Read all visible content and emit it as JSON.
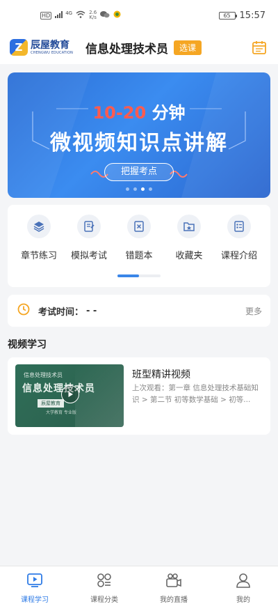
{
  "status_bar": {
    "left_badge": "HD",
    "signal_label": "4G",
    "speed_value": "2.6",
    "speed_unit": "K/s",
    "battery": "65",
    "time": "15:57"
  },
  "header": {
    "logo_cn": "辰屋教育",
    "logo_en": "CHENGWU EDUCATION",
    "title": "信息处理技术员",
    "course_select": "选课"
  },
  "banner": {
    "line1_red": "10-20",
    "line1_white": "分钟",
    "line2": "微视频知识点讲解",
    "button": "把握考点",
    "dots": [
      {
        "active": false
      },
      {
        "active": false
      },
      {
        "active": true
      },
      {
        "active": false
      }
    ]
  },
  "menu": {
    "items": [
      {
        "label": "章节练习",
        "icon": "layers-icon"
      },
      {
        "label": "模拟考试",
        "icon": "exam-paper-icon"
      },
      {
        "label": "错题本",
        "icon": "wrong-book-icon"
      },
      {
        "label": "收藏夹",
        "icon": "star-folder-icon"
      },
      {
        "label": "课程介绍",
        "icon": "course-info-icon"
      }
    ],
    "page_progress": 0.5
  },
  "exam": {
    "label": "考试时间：",
    "value": "- -",
    "more": "更多"
  },
  "video_section": {
    "title": "视频学习",
    "card": {
      "thumb_small": "信息处理技术员",
      "thumb_big": "信息处理技术员",
      "thumb_badge": "辰屋教育",
      "thumb_foot": "大学教育 专业版",
      "title": "班型精讲视频",
      "desc": "上次观看：第一章 信息处理技术基础知识 > 第二节 初等数学基础 > 初等..."
    }
  },
  "tabs": [
    {
      "label": "课程学习",
      "icon": "play-video-icon",
      "active": true
    },
    {
      "label": "课程分类",
      "icon": "category-grid-icon",
      "active": false
    },
    {
      "label": "我的直播",
      "icon": "live-camera-icon",
      "active": false
    },
    {
      "label": "我的",
      "icon": "profile-icon",
      "active": false
    }
  ],
  "colors": {
    "accent": "#2e7be6",
    "tag_orange": "#f5a623",
    "banner_red": "#ff5b4f"
  }
}
